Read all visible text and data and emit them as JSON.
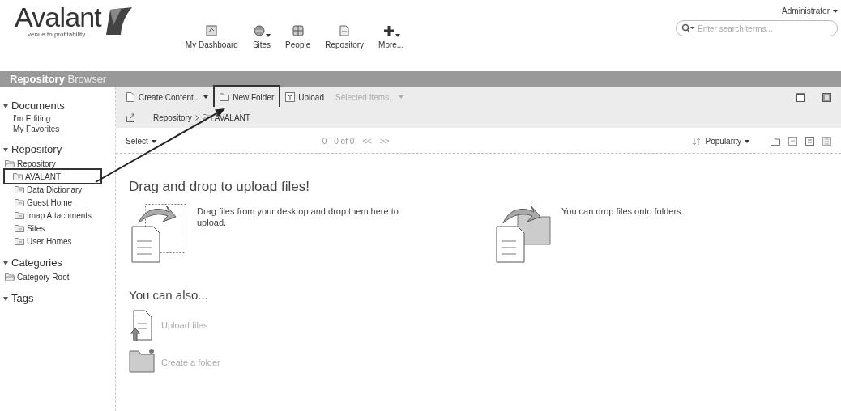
{
  "header": {
    "logo": {
      "name": "Avalant",
      "tagline": "venue to profitability"
    },
    "nav": [
      {
        "label": "My Dashboard",
        "dropdown": false
      },
      {
        "label": "Sites",
        "dropdown": true
      },
      {
        "label": "People",
        "dropdown": false
      },
      {
        "label": "Repository",
        "dropdown": false
      },
      {
        "label": "More...",
        "dropdown": true
      }
    ],
    "user_menu": "Administrator",
    "search": {
      "placeholder": "Enter search terms..."
    }
  },
  "title_bar": {
    "primary": "Repository",
    "secondary": "Browser"
  },
  "sidebar": [
    {
      "title": "Documents",
      "expanded": true,
      "kind": "links",
      "items": [
        {
          "label": "I'm Editing"
        },
        {
          "label": "My Favorites"
        }
      ]
    },
    {
      "title": "Repository",
      "expanded": true,
      "kind": "tree",
      "items": [
        {
          "label": "Repository",
          "highlighted": false,
          "children": [
            {
              "label": "AVALANT",
              "highlighted": true
            },
            {
              "label": "Data Dictionary",
              "highlighted": false
            },
            {
              "label": "Guest Home",
              "highlighted": false
            },
            {
              "label": "Imap Attachments",
              "highlighted": false
            },
            {
              "label": "Sites",
              "highlighted": false
            },
            {
              "label": "User Homes",
              "highlighted": false
            }
          ]
        }
      ]
    },
    {
      "title": "Categories",
      "expanded": true,
      "kind": "tree",
      "items": [
        {
          "label": "Category Root",
          "highlighted": false
        }
      ]
    },
    {
      "title": "Tags",
      "expanded": true,
      "kind": "links"
    }
  ],
  "toolbar": [
    {
      "label": "Create Content...",
      "kind": "menu",
      "disabled": false,
      "highlighted": false
    },
    {
      "label": "New Folder",
      "kind": "button",
      "disabled": false,
      "highlighted": true
    },
    {
      "label": "Upload",
      "kind": "button",
      "disabled": false,
      "highlighted": false
    },
    {
      "label": "Selected Items...",
      "kind": "menu",
      "disabled": true,
      "highlighted": false
    }
  ],
  "breadcrumb": [
    "Repository",
    "AVALANT"
  ],
  "list_bar": {
    "select": "Select",
    "pagination": "0 - 0 of 0",
    "previous": "<<",
    "next": ">>",
    "sort": "Popularity"
  },
  "empty_state": {
    "title": "Drag and drop to upload files!",
    "hints": [
      {
        "text": "Drag files from your desktop and drop them here to upload.",
        "kind": "drop"
      },
      {
        "text": "You can drop files onto folders.",
        "kind": "folder"
      }
    ],
    "also_title": "You can also...",
    "actions": [
      {
        "label": "Upload files",
        "kind": "upload"
      },
      {
        "label": "Create a folder",
        "kind": "folder"
      }
    ]
  }
}
